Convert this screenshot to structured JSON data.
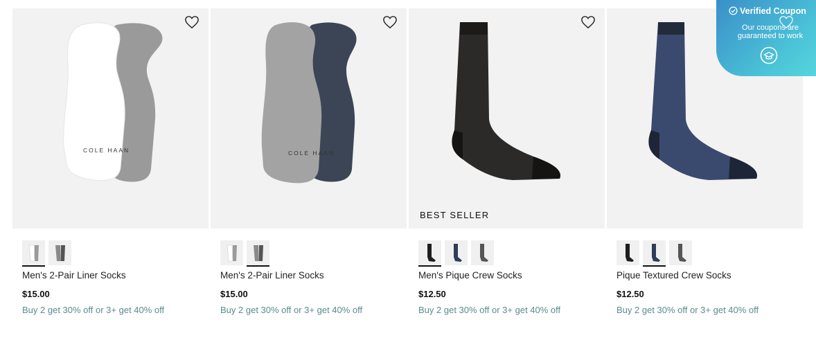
{
  "products": [
    {
      "title": "Men's 2-Pair Liner Socks",
      "price": "$15.00",
      "promo": "Buy 2 get 30% off or 3+ get 40% off",
      "badge": "",
      "sock_text": "COLE HAAN",
      "swatches": [
        {
          "name": "white-gray",
          "selected": true
        },
        {
          "name": "gray-charcoal",
          "selected": false
        }
      ]
    },
    {
      "title": "Men's 2-Pair Liner Socks",
      "price": "$15.00",
      "promo": "Buy 2 get 30% off or 3+ get 40% off",
      "badge": "",
      "sock_text": "COLE HAAN",
      "swatches": [
        {
          "name": "white-gray",
          "selected": false
        },
        {
          "name": "gray-charcoal",
          "selected": true
        }
      ]
    },
    {
      "title": "Men's Pique Crew Socks",
      "price": "$12.50",
      "promo": "Buy 2 get 30% off or 3+ get 40% off",
      "badge": "BEST SELLER",
      "swatches": [
        {
          "name": "black",
          "selected": true
        },
        {
          "name": "navy",
          "selected": false
        },
        {
          "name": "gray",
          "selected": false
        }
      ]
    },
    {
      "title": "Pique Textured Crew Socks",
      "price": "$12.50",
      "promo": "Buy 2 get 30% off or 3+ get 40% off",
      "badge": "",
      "swatches": [
        {
          "name": "black",
          "selected": false
        },
        {
          "name": "navy",
          "selected": true
        },
        {
          "name": "gray",
          "selected": false
        }
      ]
    }
  ],
  "coupon": {
    "heading": "Verified Coupon",
    "subtext_line1": "Our coupons are",
    "subtext_line2": "guaranteed to work"
  },
  "icons": {
    "wishlist": "heart-icon",
    "coupon_check": "check-circle-icon",
    "coupon_logo": "graduation-cap-icon"
  },
  "colors": {
    "promo_text": "#5b8a8f",
    "card_bg": "#f2f2f2",
    "coupon_gradient_start": "#3a8fc9",
    "coupon_gradient_end": "#56d6dd"
  }
}
